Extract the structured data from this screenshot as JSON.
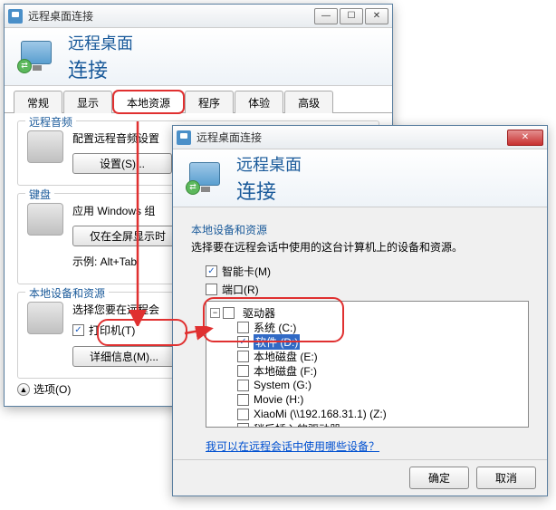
{
  "win1": {
    "title": "远程桌面连接",
    "banner": {
      "line1": "远程桌面",
      "line2": "连接"
    },
    "tabs": [
      "常规",
      "显示",
      "本地资源",
      "程序",
      "体验",
      "高级"
    ],
    "audio": {
      "title": "远程音频",
      "text": "配置远程音频设置",
      "btn": "设置(S)..."
    },
    "keyboard": {
      "title": "键盘",
      "text": "应用 Windows 组",
      "btn": "仅在全屏显示时",
      "example": "示例: Alt+Tab"
    },
    "local": {
      "title": "本地设备和资源",
      "text": "选择您要在远程会",
      "printer": "打印机(T)",
      "btn": "详细信息(M)..."
    },
    "options": "选项(O)"
  },
  "win2": {
    "title": "远程桌面连接",
    "banner": {
      "line1": "远程桌面",
      "line2": "连接"
    },
    "section_title": "本地设备和资源",
    "section_desc": "选择要在远程会话中使用的这台计算机上的设备和资源。",
    "smartcard": "智能卡(M)",
    "ports": "端口(R)",
    "drives": {
      "root": "驱动器",
      "items": [
        {
          "label": "系统 (C:)",
          "checked": false
        },
        {
          "label": "软件 (D:)",
          "checked": true,
          "selected": true
        },
        {
          "label": "本地磁盘 (E:)",
          "checked": false
        },
        {
          "label": "本地磁盘 (F:)",
          "checked": false
        },
        {
          "label": "System (G:)",
          "checked": false
        },
        {
          "label": "Movie (H:)",
          "checked": false
        },
        {
          "label": "XiaoMi (\\\\192.168.31.1) (Z:)",
          "checked": false
        },
        {
          "label": "稍后插入的驱动器",
          "checked": false
        }
      ]
    },
    "link": "我可以在远程会话中使用哪些设备？",
    "ok": "确定",
    "cancel": "取消"
  }
}
